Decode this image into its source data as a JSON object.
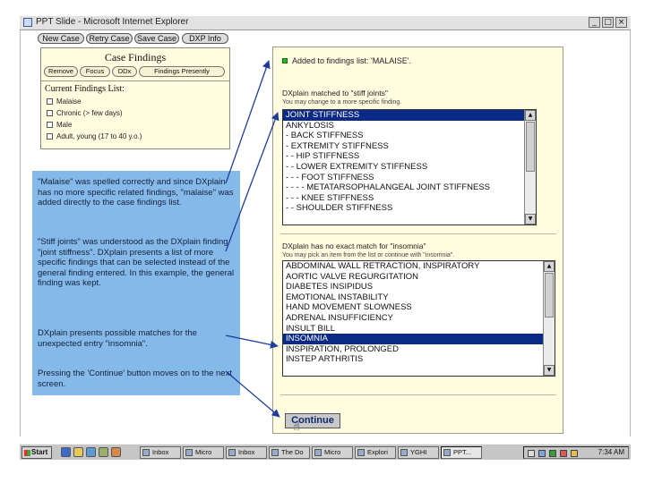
{
  "window": {
    "title": "PPT Slide - Microsoft Internet Explorer",
    "buttons": [
      "_",
      "□",
      "×"
    ]
  },
  "toolbar": {
    "buttons": [
      "New Case",
      "Retry Case",
      "Save Case",
      "DXP Info"
    ]
  },
  "case_findings": {
    "title": "Case Findings",
    "tabs": [
      "Remove",
      "Focus",
      "DDx",
      "Findings Presently"
    ],
    "list_title": "Current Findings List:",
    "items": [
      "Malaise",
      "Chronic (> few days)",
      "Male",
      "Adult, young (17 to 40 y.o.)"
    ]
  },
  "explanation": {
    "paragraphs": [
      "\"Malaise\" was spelled correctly and since DXplain has no more specific related findings, \"malaise\" was added directly to the case findings list.",
      "\"Stiff joints\" was understood as the DXplain finding \"joint stiffness\". DXplain presents a list of more specific findings that can be selected instead of the general finding entered. In this example, the general finding was kept.",
      "DXplain presents possible matches for the unexpected entry \"insomnia\".",
      "Pressing the 'Continue' button moves on to the next screen."
    ]
  },
  "main": {
    "added_text": "Added to findings list: 'MALAISE'.",
    "matched_text": "DXplain matched to \"stiff joints\"",
    "matched_hint": "You may change to a more specific finding.",
    "list1": [
      "JOINT STIFFNESS",
      "  ANKYLOSIS",
      "- BACK STIFFNESS",
      "- EXTREMITY STIFFNESS",
      "- - HIP STIFFNESS",
      "- - LOWER EXTREMITY STIFFNESS",
      "- - - FOOT STIFFNESS",
      "- - - - METATARSOPHALANGEAL JOINT STIFFNESS",
      "- - - KNEE STIFFNESS",
      "- - SHOULDER STIFFNESS"
    ],
    "list1_selected_index": 0,
    "nomatch_text": "DXplain has no exact match for \"insomnia\"",
    "nomatch_hint": "You may pick an item from the list or continue with \"insomnia\".",
    "list2": [
      "ABDOMINAL WALL RETRACTION, INSPIRATORY",
      "AORTIC VALVE REGURGITATION",
      "DIABETES INSIPIDUS",
      "EMOTIONAL INSTABILITY",
      "HAND MOVEMENT SLOWNESS",
      "ADRENAL INSUFFICIENCY",
      "INSULT BILL",
      "INSOMNIA",
      "INSPIRATION, PROLONGED",
      "INSTEP ARTHRITIS"
    ],
    "list2_selected_index": 7,
    "continue_label": "Continue"
  },
  "taskbar": {
    "start_label": "Start",
    "items": [
      "Inbox",
      "Micro",
      "Inbox",
      "The Do",
      "Micro",
      "Explori",
      "YGHI",
      "PPT..."
    ],
    "active_index": 7,
    "clock": "7:34 AM"
  },
  "colors": {
    "explanation_bg": "#85b9ea",
    "panel_bg": "#fffce0",
    "selection": "#0b2a85",
    "arrows": "#1f3c9c"
  }
}
